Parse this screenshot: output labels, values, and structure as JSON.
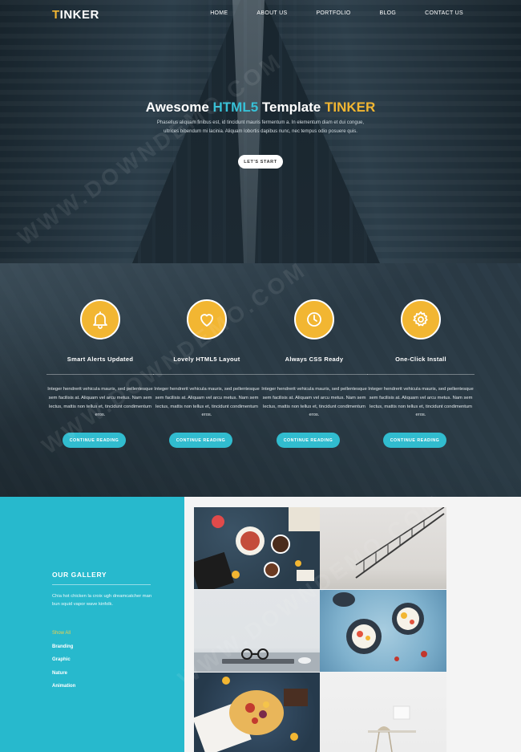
{
  "brand": {
    "logo_first": "T",
    "logo_rest": "INKER"
  },
  "nav": [
    "HOME",
    "ABOUT US",
    "PORTFOLIO",
    "BLOG",
    "CONTACT US"
  ],
  "hero": {
    "title_a": "Awesome ",
    "title_b": "HTML5",
    "title_c": " Template ",
    "title_d": "TINKER",
    "text": "Phasellus aliquam finibus est, id tincidunt mauris fermentum a. In elementum diam et dui congue, ultrices bibendum mi lacinia. Aliquam lobortis dapibus nunc, nec tempus odio posuere quis.",
    "button": "LET'S START"
  },
  "features": [
    {
      "icon": "bell-icon",
      "title": "Smart Alerts Updated",
      "text": "Integer hendrerit vehicula mauris, sed pellentesque sem facilisis at. Aliquam vel arcu metus. Nam sem lectus, mattis non tellus et, tincidunt condimentum eros.",
      "button": "CONTINUE READING"
    },
    {
      "icon": "heart-icon",
      "title": "Lovely HTML5 Layout",
      "text": "Integer hendrerit vehicula mauris, sed pellentesque sem facilisis at. Aliquam vel arcu metus. Nam sem lectus, mattis non tellus et, tincidunt condimentum eros.",
      "button": "CONTINUE READING"
    },
    {
      "icon": "clock-icon",
      "title": "Always CSS Ready",
      "text": "Integer hendrerit vehicula mauris, sed pellentesque sem facilisis at. Aliquam vel arcu metus. Nam sem lectus, mattis non tellus et, tincidunt condimentum eros.",
      "button": "CONTINUE READING"
    },
    {
      "icon": "gear-icon",
      "title": "One-Click Install",
      "text": "Integer hendrerit vehicula mauris, sed pellentesque sem facilisis at. Aliquam vel arcu metus. Nam sem lectus, mattis non tellus et, tincidunt condimentum eros.",
      "button": "CONTINUE READING"
    }
  ],
  "gallery": {
    "title": "OUR GALLERY",
    "description": "Chia hot chicken la croix ugh dreamcatcher man bun squid vapor wave kinfolk.",
    "filters": [
      "Show All",
      "Branding",
      "Graphic",
      "Nature",
      "Animation"
    ]
  },
  "watermark": "WWW.DOWNDEMO.COM",
  "colors": {
    "accent": "#37c0d6",
    "brand_yellow": "#f2b632",
    "gallery_bg": "#27b9cd"
  }
}
